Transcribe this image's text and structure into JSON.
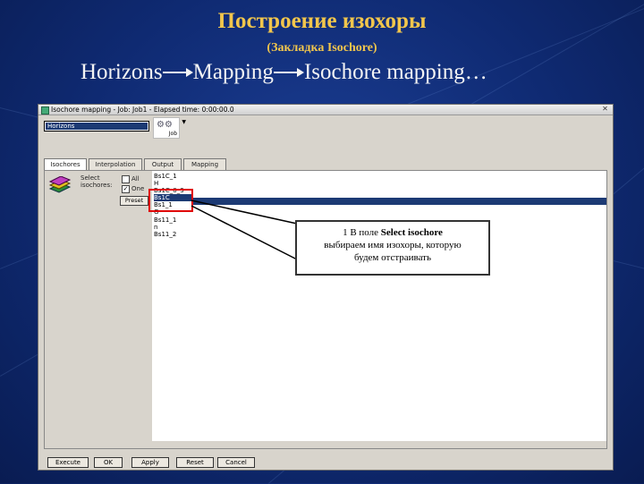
{
  "slide": {
    "title": "Построение изохоры",
    "subtitle": "(Закладка Isochore)",
    "path": [
      "Horizons",
      "Mapping",
      "Isochore mapping…"
    ]
  },
  "window": {
    "title": "Isochore mapping - Job: Job1 - Elapsed time: 0:00:00.0",
    "job_field": "Horizons",
    "job_icon_label": "Job",
    "tabs": [
      "Isochores",
      "Interpolation",
      "Output",
      "Mapping"
    ],
    "active_tab": "Isochores",
    "options": {
      "select_label": "Select",
      "isochores_label": "isochores:",
      "all_label": "All",
      "one_label": "One",
      "one_checked": true,
      "preset_button": "Preset"
    },
    "isochore_list": [
      "Bs1C_1",
      "H",
      "Bs1C_0_3",
      "Bs1C",
      "Bs1_1",
      "G",
      "Bs11_1",
      "n",
      "Bs11_2"
    ],
    "selected_index": 3,
    "buttons": [
      "Execute",
      "OK",
      "Apply",
      "Reset",
      "Cancel"
    ]
  },
  "callout": {
    "number": "1",
    "line1": "В поле",
    "bold": "Select isochore",
    "line2": "выбираем имя изохоры, которую",
    "line3": "будем отстраивать"
  },
  "colors": {
    "title": "#f2c64c",
    "background": "#13358a",
    "highlight": "#1c3a74",
    "red_box": "#e00000"
  }
}
